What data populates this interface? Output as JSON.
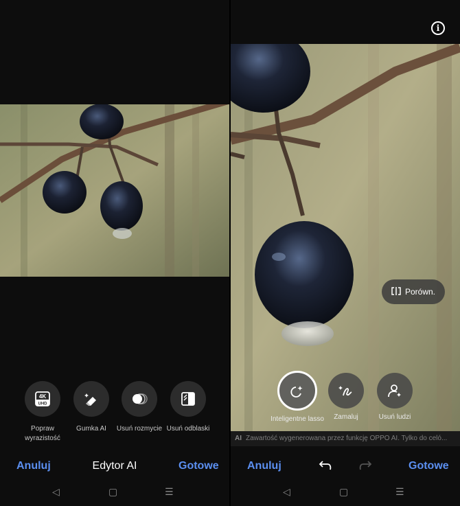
{
  "left": {
    "tools": [
      {
        "label": "Popraw wyrazistość",
        "icon": "4k-uhd-icon"
      },
      {
        "label": "Gumka AI",
        "icon": "eraser-icon"
      },
      {
        "label": "Usuń rozmycie",
        "icon": "blur-icon"
      },
      {
        "label": "Usuń odblaski",
        "icon": "reflection-icon"
      }
    ],
    "cancel_label": "Anuluj",
    "title": "Edytor AI",
    "done_label": "Gotowe",
    "icon_4k_top": "4K",
    "icon_4k_bottom": "UHD"
  },
  "right": {
    "compare_label": "Porówn.",
    "tools": [
      {
        "label": "Inteligentne lasso",
        "icon": "smart-lasso-icon",
        "active": true
      },
      {
        "label": "Zamaluj",
        "icon": "paint-over-icon",
        "active": false
      },
      {
        "label": "Usuń ludzi",
        "icon": "remove-people-icon",
        "active": false
      }
    ],
    "ai_note": "Zawartość wygenerowana przez funkcję OPPO AI. Tylko do celó...",
    "ai_mark": "AI",
    "cancel_label": "Anuluj",
    "done_label": "Gotowe"
  },
  "nav": {
    "back": "◁",
    "home": "▢",
    "menu": "☰"
  },
  "colors": {
    "accent": "#5b8ff0",
    "panel_bg": "#0d0d0d",
    "tool_bg": "#2c2c2c"
  }
}
